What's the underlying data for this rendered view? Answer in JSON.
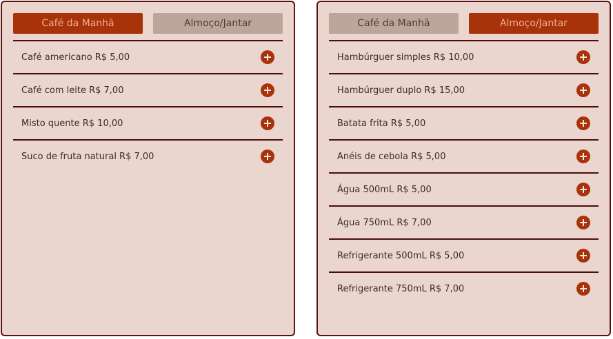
{
  "colors": {
    "panel_background": "#ead6ce",
    "panel_border": "#5c0f0f",
    "active_tab": "#a8320a",
    "inactive_tab": "#bca69c",
    "add_button": "#a8320a"
  },
  "icons": {
    "add": "plus-circle-icon"
  },
  "left_panel": {
    "tabs": [
      {
        "label": "Café da Manhã",
        "active": true
      },
      {
        "label": "Almoço/Jantar",
        "active": false
      }
    ],
    "items": [
      {
        "label": "Café americano R$ 5,00"
      },
      {
        "label": "Café com leite R$ 7,00"
      },
      {
        "label": "Misto quente R$ 10,00"
      },
      {
        "label": "Suco de fruta natural R$ 7,00"
      }
    ]
  },
  "right_panel": {
    "tabs": [
      {
        "label": "Café da Manhã",
        "active": false
      },
      {
        "label": "Almoço/Jantar",
        "active": true
      }
    ],
    "items": [
      {
        "label": "Hambúrguer simples R$ 10,00"
      },
      {
        "label": "Hambúrguer duplo R$ 15,00"
      },
      {
        "label": "Batata frita R$ 5,00"
      },
      {
        "label": "Anéis de cebola R$ 5,00"
      },
      {
        "label": "Água 500mL R$ 5,00"
      },
      {
        "label": "Água 750mL R$ 7,00"
      },
      {
        "label": "Refrigerante 500mL R$ 5,00"
      },
      {
        "label": "Refrigerante 750mL R$ 7,00"
      }
    ]
  }
}
